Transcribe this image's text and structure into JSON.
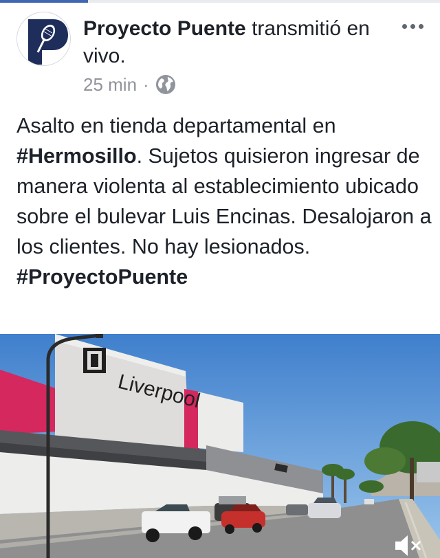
{
  "progress": {
    "fraction": 0.2
  },
  "post": {
    "page_name": "Proyecto Puente",
    "action_text": " transmitió en vivo.",
    "timestamp": "25 min",
    "separator": "·",
    "privacy_icon": "globe-icon",
    "more_icon": "more-dots-icon",
    "body": {
      "p1": "Asalto en tienda departamental en ",
      "hashtag1": "#Hermosillo",
      "p2": ". Sujetos quisieron ingresar de manera violenta al establecimiento ubicado sobre el bulevar Luis Encinas. Desalojaron a los clientes. No hay lesionados. ",
      "hashtag2": "#ProyectoPuente"
    }
  },
  "video": {
    "store_sign": "Liverpool",
    "mute_icon": "speaker-muted-icon"
  },
  "colors": {
    "accent": "#4267b2",
    "text": "#1d2129",
    "secondary_text": "#90949c",
    "avatar_navy": "#1e2d5a"
  }
}
